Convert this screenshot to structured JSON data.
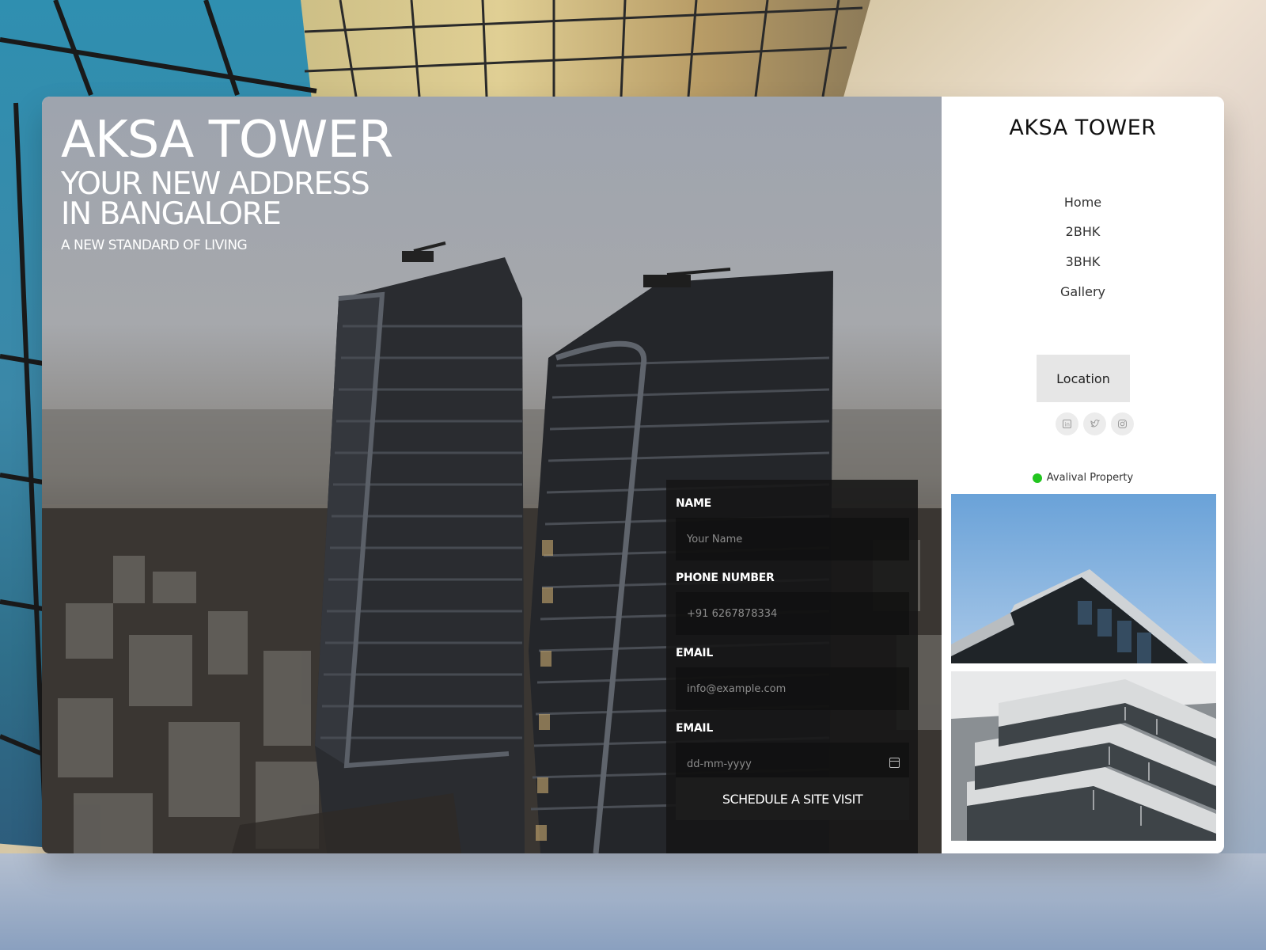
{
  "hero": {
    "title": "AKSA TOWER",
    "subtitle_line1": "YOUR NEW ADDRESS",
    "subtitle_line2": "IN BANGALORE",
    "tagline": "A NEW STANDARD OF LIVING"
  },
  "form": {
    "name_label": "NAME",
    "name_placeholder": "Your Name",
    "phone_label": "PHONE NUMBER",
    "phone_placeholder": "+91 6267878334",
    "email_label": "EMAIL",
    "email_placeholder": "info@example.com",
    "date_label": "EMAIL",
    "date_placeholder": "dd-mm-yyyy",
    "submit_label": "SCHEDULE A SITE VISIT"
  },
  "sidebar": {
    "brand": "AKSA TOWER",
    "nav": [
      {
        "label": "Home"
      },
      {
        "label": "2BHK"
      },
      {
        "label": "3BHK"
      },
      {
        "label": "Gallery"
      }
    ],
    "location_label": "Location",
    "social_icons": [
      "linkedin-icon",
      "twitter-icon",
      "instagram-icon"
    ],
    "status_label": "Avalival Property",
    "status_color": "#22c51f"
  }
}
